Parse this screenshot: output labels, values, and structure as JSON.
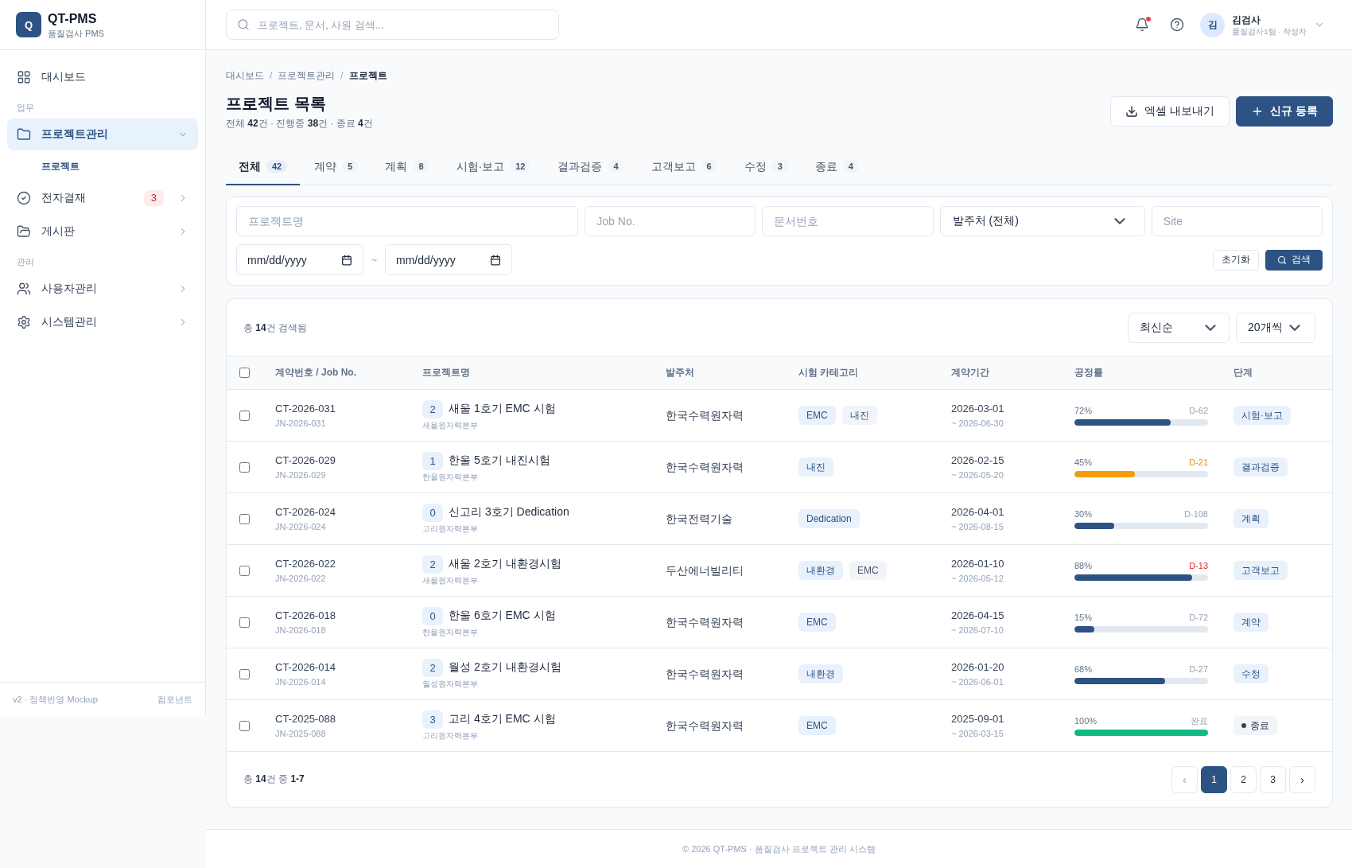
{
  "sidebar": {
    "brand": {
      "logo": "Q",
      "name": "QT-PMS",
      "subtitle": "품질검사 PMS"
    },
    "items": [
      {
        "kind": "link",
        "label": "대시보드",
        "selected": false
      },
      {
        "kind": "section",
        "label": "업무"
      },
      {
        "kind": "group",
        "label": "프로젝트관리",
        "selected": true,
        "expanded": true,
        "children": [
          {
            "label": "프로젝트",
            "selected": true
          }
        ]
      },
      {
        "kind": "group",
        "label": "전자결재",
        "selected": false,
        "expanded": false,
        "badge": "3"
      },
      {
        "kind": "group",
        "label": "게시판",
        "selected": false,
        "expanded": false
      },
      {
        "kind": "section",
        "label": "관리"
      },
      {
        "kind": "group",
        "label": "사용자관리",
        "selected": false,
        "expanded": false
      },
      {
        "kind": "group",
        "label": "시스템관리",
        "selected": false,
        "expanded": false
      }
    ],
    "footer": {
      "version": "v2 · 정책반영 Mockup",
      "link": "컴포넌트"
    }
  },
  "header": {
    "search": {
      "placeholder": "프로젝트, 문서, 사원 검색..."
    },
    "notifications": {
      "unread": true
    },
    "user": {
      "initial": "김",
      "name": "김검사",
      "role": "품질검사1팀 · 작성자"
    }
  },
  "breadcrumb": {
    "separator": "/",
    "items": [
      {
        "label": "대시보드",
        "current": false
      },
      {
        "label": "프로젝트관리",
        "current": false
      },
      {
        "label": "프로젝트",
        "current": true
      }
    ]
  },
  "page": {
    "title": "프로젝트 목록",
    "summary": "전체 **42**건 · 진행중 **38**건 · 종료 **4**건",
    "actions": [
      {
        "kind": "secondary",
        "label": "엑셀 내보내기"
      },
      {
        "kind": "primary",
        "label": "신규 등록"
      }
    ]
  },
  "tabs": [
    {
      "label": "전체",
      "count": "42",
      "selected": true
    },
    {
      "label": "계약",
      "count": "5",
      "selected": false
    },
    {
      "label": "계획",
      "count": "8",
      "selected": false
    },
    {
      "label": "시험·보고",
      "count": "12",
      "selected": false
    },
    {
      "label": "결과검증",
      "count": "4",
      "selected": false
    },
    {
      "label": "고객보고",
      "count": "6",
      "selected": false
    },
    {
      "label": "수정",
      "count": "3",
      "selected": false
    },
    {
      "label": "종료",
      "count": "4",
      "selected": false
    }
  ],
  "filters": {
    "fields": [
      {
        "kind": "text",
        "placeholder": "프로젝트명"
      },
      {
        "kind": "text",
        "placeholder": "Job No."
      },
      {
        "kind": "text",
        "placeholder": "문서번호"
      },
      {
        "kind": "select",
        "value": "발주처 (전체)"
      },
      {
        "kind": "text",
        "placeholder": "Site"
      }
    ],
    "date_range": {
      "from": {
        "placeholder": "mm/dd/yyyy"
      },
      "separator": "~",
      "to": {
        "placeholder": "mm/dd/yyyy"
      }
    },
    "buttons": [
      {
        "kind": "secondary",
        "label": "초기화"
      },
      {
        "kind": "primary",
        "label": "검색"
      }
    ]
  },
  "results": {
    "summary": "총 **14**건 검색됨",
    "sort": {
      "value": "최신순"
    },
    "page_size": {
      "value": "20개씩"
    }
  },
  "table": {
    "select_all": {
      "checked": false
    },
    "columns": [
      "계약번호 / Job No.",
      "프로젝트명",
      "발주처",
      "시험 카테고리",
      "계약기간",
      "공정률",
      "단계"
    ],
    "rows": [
      {
        "checked": false,
        "contract": "CT-2026-031",
        "job": "JN-2026-031",
        "badge": "2",
        "name": "새울 1호기 EMC 시험",
        "site": "새울원자력본부",
        "client": "한국수력원자력",
        "categories": [
          {
            "label": "EMC",
            "primary": true
          },
          {
            "label": "내진",
            "primary": false
          }
        ],
        "start": "2026-03-01",
        "end": "~ 2026-06-30",
        "progress": {
          "level": 0.72,
          "percent": "72%",
          "color": "#2c5383"
        },
        "dday": {
          "label": "D-62",
          "color": "#94a3b8"
        },
        "stage": {
          "label": "시험·보고",
          "closed": false
        }
      },
      {
        "checked": false,
        "contract": "CT-2026-029",
        "job": "JN-2026-029",
        "badge": "1",
        "name": "한울 5호기 내진시험",
        "site": "한울원자력본부",
        "client": "한국수력원자력",
        "categories": [
          {
            "label": "내진",
            "primary": true
          }
        ],
        "start": "2026-02-15",
        "end": "~ 2026-05-20",
        "progress": {
          "level": 0.45,
          "percent": "45%",
          "color": "#f59e0b"
        },
        "dday": {
          "label": "D-21",
          "color": "#e8900c"
        },
        "stage": {
          "label": "결과검증",
          "closed": false
        }
      },
      {
        "checked": false,
        "contract": "CT-2026-024",
        "job": "JN-2026-024",
        "badge": "0",
        "name": "신고리 3호기 Dedication",
        "site": "고리원자력본부",
        "client": "한국전력기술",
        "categories": [
          {
            "label": "Dedication",
            "primary": true
          }
        ],
        "start": "2026-04-01",
        "end": "~ 2026-08-15",
        "progress": {
          "level": 0.3,
          "percent": "30%",
          "color": "#2c5383"
        },
        "dday": {
          "label": "D-108",
          "color": "#94a3b8"
        },
        "stage": {
          "label": "계획",
          "closed": false
        }
      },
      {
        "checked": false,
        "contract": "CT-2026-022",
        "job": "JN-2026-022",
        "badge": "2",
        "name": "새울 2호기 내환경시험",
        "site": "새울원자력본부",
        "client": "두산에너빌리티",
        "categories": [
          {
            "label": "내환경",
            "primary": true
          },
          {
            "label": "EMC",
            "primary": false
          }
        ],
        "start": "2026-01-10",
        "end": "~ 2026-05-12",
        "progress": {
          "level": 0.88,
          "percent": "88%",
          "color": "#2c5383"
        },
        "dday": {
          "label": "D-13",
          "color": "#e02424"
        },
        "stage": {
          "label": "고객보고",
          "closed": false
        }
      },
      {
        "checked": false,
        "contract": "CT-2026-018",
        "job": "JN-2026-018",
        "badge": "0",
        "name": "한울 6호기 EMC 시험",
        "site": "한울원자력본부",
        "client": "한국수력원자력",
        "categories": [
          {
            "label": "EMC",
            "primary": true
          }
        ],
        "start": "2026-04-15",
        "end": "~ 2026-07-10",
        "progress": {
          "level": 0.15,
          "percent": "15%",
          "color": "#2c5383"
        },
        "dday": {
          "label": "D-72",
          "color": "#94a3b8"
        },
        "stage": {
          "label": "계약",
          "closed": false
        }
      },
      {
        "checked": false,
        "contract": "CT-2026-014",
        "job": "JN-2026-014",
        "badge": "2",
        "name": "월성 2호기 내환경시험",
        "site": "월성원자력본부",
        "client": "한국수력원자력",
        "categories": [
          {
            "label": "내환경",
            "primary": true
          }
        ],
        "start": "2026-01-20",
        "end": "~ 2026-06-01",
        "progress": {
          "level": 0.68,
          "percent": "68%",
          "color": "#2c5383"
        },
        "dday": {
          "label": "D-27",
          "color": "#94a3b8"
        },
        "stage": {
          "label": "수정",
          "closed": false
        }
      },
      {
        "checked": false,
        "contract": "CT-2025-088",
        "job": "JN-2025-088",
        "badge": "3",
        "name": "고리 4호기 EMC 시험",
        "site": "고리원자력본부",
        "client": "한국수력원자력",
        "categories": [
          {
            "label": "EMC",
            "primary": true
          }
        ],
        "start": "2025-09-01",
        "end": "~ 2026-03-15",
        "progress": {
          "level": 1,
          "percent": "100%",
          "color": "#10b981"
        },
        "dday": {
          "label": "완료",
          "color": "#94a3b8"
        },
        "stage": {
          "label": "종료",
          "closed": true
        }
      }
    ]
  },
  "pagination": {
    "summary": "총 **14**건 중 **1-7**",
    "prev": {
      "label": "‹",
      "disabled": true
    },
    "pages": [
      {
        "label": "1",
        "selected": true
      },
      {
        "label": "2",
        "selected": false
      },
      {
        "label": "3",
        "selected": false
      }
    ],
    "next": {
      "label": "›",
      "disabled": false
    }
  },
  "footer": {
    "text": "© 2026 QT-PMS · 품질검사 프로젝트 관리 시스템"
  }
}
